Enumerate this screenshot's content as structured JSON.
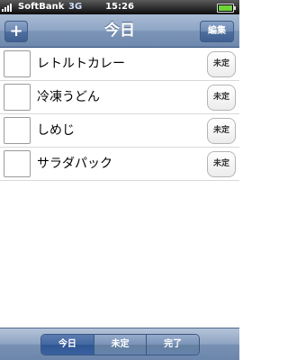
{
  "status_bar": {
    "carrier": "SoftBank",
    "network": "3G",
    "time": "15:26",
    "battery_level": 1.0
  },
  "nav": {
    "title": "今日",
    "add_label": "+",
    "edit_label": "編集"
  },
  "items": [
    {
      "label": "レトルトカレー",
      "status": "未定"
    },
    {
      "label": "冷凍うどん",
      "status": "未定"
    },
    {
      "label": "しめじ",
      "status": "未定"
    },
    {
      "label": "サラダパック",
      "status": "未定"
    }
  ],
  "toolbar": {
    "segments": [
      "今日",
      "未定",
      "完了"
    ],
    "selected_index": 0
  },
  "colors": {
    "nav_bar": "#8ea5c5",
    "toolbar": "#7890b3",
    "selected_segment": "#3a62a0",
    "battery": "#6fd33a"
  }
}
